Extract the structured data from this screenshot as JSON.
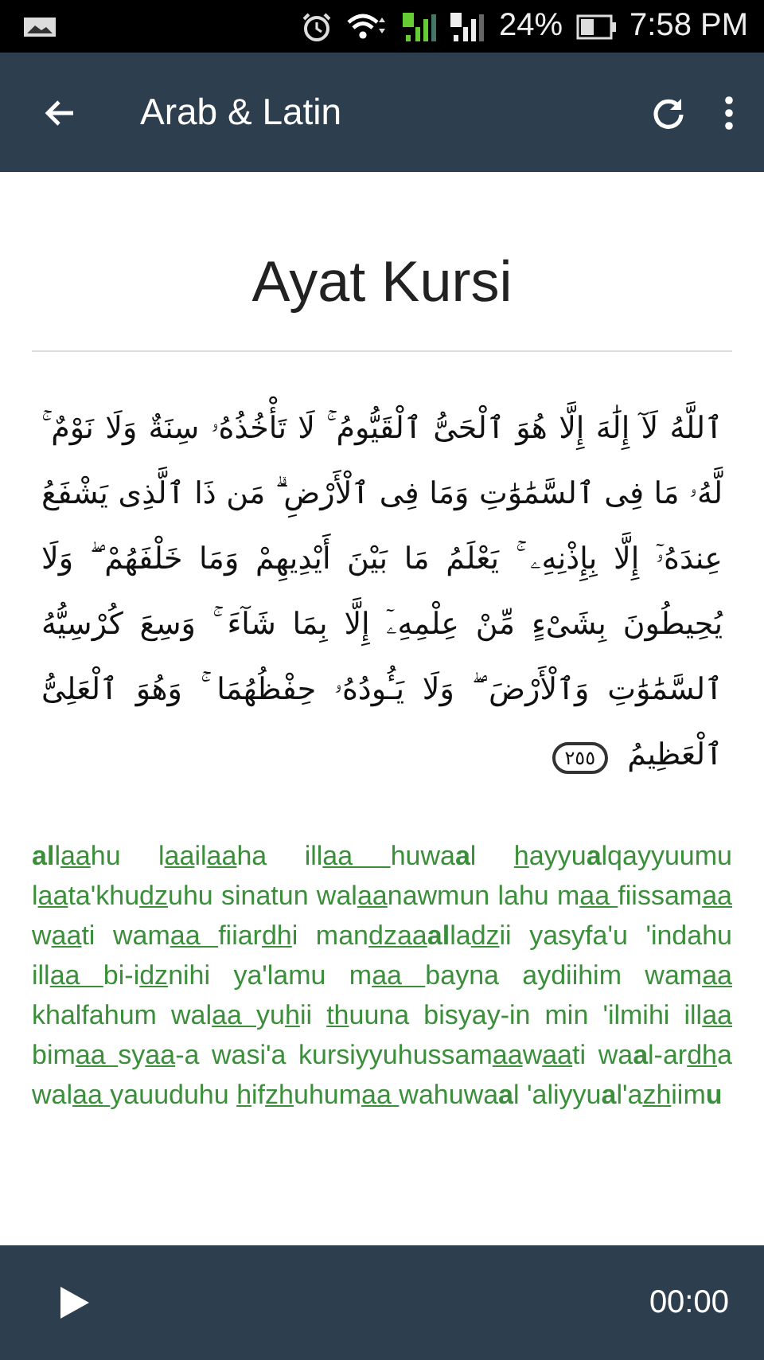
{
  "status_bar": {
    "battery_text": "24%",
    "time": "7:58 PM"
  },
  "app_bar": {
    "title": "Arab & Latin"
  },
  "title": "Ayat Kursi",
  "arabic": "ٱللَّهُ لَآ إِلَٰهَ إِلَّا هُوَ ٱلْحَىُّ ٱلْقَيُّومُ ۚ لَا تَأْخُذُهُۥ سِنَةٌ وَلَا نَوْمٌ ۚ لَّهُۥ مَا فِى ٱلسَّمَٰوَٰتِ وَمَا فِى ٱلْأَرْضِ ۗ مَن ذَا ٱلَّذِى يَشْفَعُ عِندَهُۥٓ إِلَّا بِإِذْنِهِۦ ۚ يَعْلَمُ مَا بَيْنَ أَيْدِيهِمْ وَمَا خَلْفَهُمْ ۖ وَلَا يُحِيطُونَ بِشَىْءٍ مِّنْ عِلْمِهِۦٓ إِلَّا بِمَا شَآءَ ۚ وَسِعَ كُرْسِيُّهُ ٱلسَّمَٰوَٰتِ وَٱلْأَرْضَ ۖ وَلَا يَـُٔودُهُۥ حِفْظُهُمَا ۚ وَهُوَ ٱلْعَلِىُّ ٱلْعَظِيمُ",
  "verse_number": "٢٥٥",
  "latin": [
    {
      "text": "al",
      "kind": "bold"
    },
    {
      "text": "l",
      "kind": "plain"
    },
    {
      "text": "aa",
      "kind": "underline"
    },
    {
      "text": "hu l",
      "kind": "plain"
    },
    {
      "text": "aa",
      "kind": "underline"
    },
    {
      "text": "il",
      "kind": "plain"
    },
    {
      "text": "aa",
      "kind": "underline"
    },
    {
      "text": "ha ill",
      "kind": "plain"
    },
    {
      "text": "aa ",
      "kind": "underline"
    },
    {
      "text": "huwa",
      "kind": "plain"
    },
    {
      "text": "a",
      "kind": "bold"
    },
    {
      "text": "l ",
      "kind": "plain"
    },
    {
      "text": "h",
      "kind": "underline"
    },
    {
      "text": "ayyu",
      "kind": "plain"
    },
    {
      "text": "a",
      "kind": "bold"
    },
    {
      "text": "lqayyuumu l",
      "kind": "plain"
    },
    {
      "text": "aa",
      "kind": "underline"
    },
    {
      "text": "ta'khu",
      "kind": "plain"
    },
    {
      "text": "dz",
      "kind": "underline"
    },
    {
      "text": "uhu sinatun wal",
      "kind": "plain"
    },
    {
      "text": "aa",
      "kind": "underline"
    },
    {
      "text": "nawmun lahu m",
      "kind": "plain"
    },
    {
      "text": "aa ",
      "kind": "underline"
    },
    {
      "text": "fiissam",
      "kind": "plain"
    },
    {
      "text": "aa ",
      "kind": "underline"
    },
    {
      "text": "w",
      "kind": "plain"
    },
    {
      "text": "aa",
      "kind": "underline"
    },
    {
      "text": "ti wam",
      "kind": "plain"
    },
    {
      "text": "aa ",
      "kind": "underline"
    },
    {
      "text": "fiiar",
      "kind": "plain"
    },
    {
      "text": "dh",
      "kind": "underline"
    },
    {
      "text": "i man",
      "kind": "plain"
    },
    {
      "text": "dzaa",
      "kind": "underline"
    },
    {
      "text": "al",
      "kind": "bold"
    },
    {
      "text": "la",
      "kind": "plain"
    },
    {
      "text": "dz",
      "kind": "underline"
    },
    {
      "text": "ii yasyfa'u 'indahu ill",
      "kind": "plain"
    },
    {
      "text": "aa ",
      "kind": "underline"
    },
    {
      "text": "bi-i",
      "kind": "plain"
    },
    {
      "text": "dz",
      "kind": "underline"
    },
    {
      "text": "nihi ya'lamu m",
      "kind": "plain"
    },
    {
      "text": "aa ",
      "kind": "underline"
    },
    {
      "text": "bayna aydiihim wam",
      "kind": "plain"
    },
    {
      "text": "aa ",
      "kind": "underline"
    },
    {
      "text": "khalfahum wal",
      "kind": "plain"
    },
    {
      "text": "aa ",
      "kind": "underline"
    },
    {
      "text": "yu",
      "kind": "plain"
    },
    {
      "text": "h",
      "kind": "underline"
    },
    {
      "text": "ii ",
      "kind": "plain"
    },
    {
      "text": "th",
      "kind": "underline"
    },
    {
      "text": "uuna bisyay-in min 'ilmihi ill",
      "kind": "plain"
    },
    {
      "text": "aa ",
      "kind": "underline"
    },
    {
      "text": "bim",
      "kind": "plain"
    },
    {
      "text": "aa ",
      "kind": "underline"
    },
    {
      "text": "sy",
      "kind": "plain"
    },
    {
      "text": "aa",
      "kind": "underline"
    },
    {
      "text": "-a wasi'a kursiyyuhussam",
      "kind": "plain"
    },
    {
      "text": "aa",
      "kind": "underline"
    },
    {
      "text": "w",
      "kind": "plain"
    },
    {
      "text": "aa",
      "kind": "underline"
    },
    {
      "text": "ti wa",
      "kind": "plain"
    },
    {
      "text": "a",
      "kind": "bold"
    },
    {
      "text": "l-ar",
      "kind": "plain"
    },
    {
      "text": "dh",
      "kind": "underline"
    },
    {
      "text": "a wal",
      "kind": "plain"
    },
    {
      "text": "aa ",
      "kind": "underline"
    },
    {
      "text": "yauuduhu ",
      "kind": "plain"
    },
    {
      "text": "h",
      "kind": "underline"
    },
    {
      "text": "if",
      "kind": "plain"
    },
    {
      "text": "zh",
      "kind": "underline"
    },
    {
      "text": "uhum",
      "kind": "plain"
    },
    {
      "text": "aa ",
      "kind": "underline"
    },
    {
      "text": "wahuwa",
      "kind": "plain"
    },
    {
      "text": "a",
      "kind": "bold"
    },
    {
      "text": "l 'aliyyu",
      "kind": "plain"
    },
    {
      "text": "a",
      "kind": "bold"
    },
    {
      "text": "l'a",
      "kind": "plain"
    },
    {
      "text": "zh",
      "kind": "underline"
    },
    {
      "text": "iim",
      "kind": "plain"
    },
    {
      "text": "u",
      "kind": "bold"
    }
  ],
  "player": {
    "time": "00:00"
  }
}
